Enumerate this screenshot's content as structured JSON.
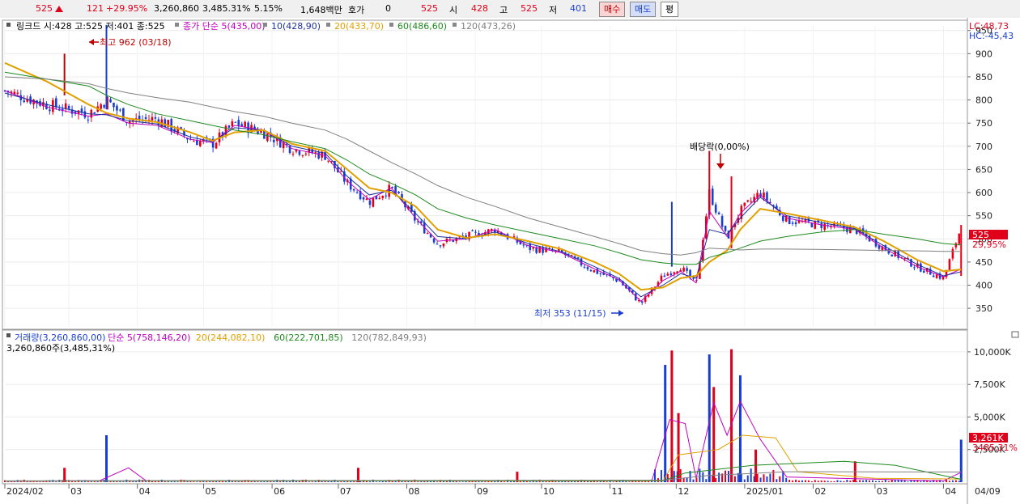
{
  "topbar": {
    "price": "525",
    "change": "121",
    "change_pct": "+29.95%",
    "volume": "3,260,860",
    "volume_pct": "3,485.31%",
    "turnover_rate": "5.15%",
    "amount": "1,648백만",
    "quote_label": "호가",
    "quote_value": "0",
    "quote_price": "525",
    "open_label": "시",
    "open_value": "428",
    "high_label": "고",
    "high_value": "525",
    "low_label": "저",
    "low_value": "401",
    "buy_label": "매수",
    "sell_label": "매도",
    "flat_label": "평"
  },
  "price_panel": {
    "stock_label": "링크드 시:428 고:525 저:401 종:525",
    "ma_legend": [
      {
        "label": "종가 단순 5(435,00)",
        "color": "#c000c0"
      },
      {
        "label": "10(428,90)",
        "color": "#1c2f9c"
      },
      {
        "label": "20(433,70)",
        "color": "#e0a000"
      },
      {
        "label": "60(486,60)",
        "color": "#1e8a1e"
      },
      {
        "label": "120(473,26)",
        "color": "#808080"
      }
    ],
    "lc_label": "LC:48,73",
    "hc_label": "HC:-45,43",
    "annotation_high": "최고 962 (03/18)",
    "annotation_low": "최저 353 (11/15)",
    "annotation_dividend": "배당락(0,00%)",
    "current_price_tag": "525",
    "current_pct_tag": "29,95%"
  },
  "volume_panel": {
    "legend": [
      {
        "label": "거래량(3,260,860,00)",
        "color": "#1a3fd0"
      },
      {
        "label": "단순 5(758,146,20)",
        "color": "#c000c0"
      },
      {
        "label": "20(244,082,10)",
        "color": "#e0a000"
      },
      {
        "label": "60(222,701,85)",
        "color": "#1e8a1e"
      },
      {
        "label": "120(782,849,93)",
        "color": "#808080"
      }
    ],
    "volume_text": "3,260,860주(3,485,31%)",
    "current_volume_tag": "3,261K",
    "current_volume_pct_tag": "3485,31%"
  },
  "chart_data": [
    {
      "type": "candlestick",
      "title": "링크드",
      "y_ticks": [
        350,
        400,
        450,
        500,
        550,
        600,
        650,
        700,
        750,
        800,
        850,
        900,
        950
      ],
      "ylim": [
        310,
        960
      ],
      "x_month_labels": [
        "2024/02",
        "03",
        "04",
        "05",
        "06",
        "07",
        "08",
        "09",
        "10",
        "11",
        "12",
        "2025/01",
        "02",
        "03",
        "04",
        "04/09"
      ],
      "close_trend": [
        {
          "date": "2024-02-01",
          "close": 820
        },
        {
          "date": "2024-02-20",
          "close": 790
        },
        {
          "date": "2024-03-10",
          "close": 770
        },
        {
          "date": "2024-03-18",
          "close": 800
        },
        {
          "date": "2024-03-28",
          "close": 755
        },
        {
          "date": "2024-04-10",
          "close": 760
        },
        {
          "date": "2024-04-25",
          "close": 715
        },
        {
          "date": "2024-05-05",
          "close": 705
        },
        {
          "date": "2024-05-15",
          "close": 750
        },
        {
          "date": "2024-05-28",
          "close": 730
        },
        {
          "date": "2024-06-10",
          "close": 695
        },
        {
          "date": "2024-06-25",
          "close": 680
        },
        {
          "date": "2024-07-05",
          "close": 620
        },
        {
          "date": "2024-07-15",
          "close": 580
        },
        {
          "date": "2024-07-25",
          "close": 610
        },
        {
          "date": "2024-08-05",
          "close": 540
        },
        {
          "date": "2024-08-15",
          "close": 490
        },
        {
          "date": "2024-08-28",
          "close": 505
        },
        {
          "date": "2024-09-10",
          "close": 520
        },
        {
          "date": "2024-09-25",
          "close": 480
        },
        {
          "date": "2024-10-10",
          "close": 470
        },
        {
          "date": "2024-10-25",
          "close": 430
        },
        {
          "date": "2024-11-05",
          "close": 410
        },
        {
          "date": "2024-11-15",
          "close": 360
        },
        {
          "date": "2024-11-25",
          "close": 420
        },
        {
          "date": "2024-12-03",
          "close": 440
        },
        {
          "date": "2024-12-10",
          "close": 400
        },
        {
          "date": "2024-12-16",
          "close": 600
        },
        {
          "date": "2024-12-24",
          "close": 500
        },
        {
          "date": "2024-12-30",
          "close": 560
        },
        {
          "date": "2025-01-08",
          "close": 600
        },
        {
          "date": "2025-01-20",
          "close": 540
        },
        {
          "date": "2025-02-05",
          "close": 530
        },
        {
          "date": "2025-02-20",
          "close": 520
        },
        {
          "date": "2025-03-05",
          "close": 480
        },
        {
          "date": "2025-03-20",
          "close": 440
        },
        {
          "date": "2025-04-01",
          "close": 415
        },
        {
          "date": "2025-04-09",
          "close": 525
        }
      ],
      "series": [
        {
          "name": "5",
          "color": "#c000c0",
          "values": [
            820,
            785,
            765,
            770,
            750,
            745,
            715,
            708,
            745,
            735,
            695,
            680,
            625,
            585,
            610,
            545,
            495,
            500,
            520,
            485,
            470,
            435,
            412,
            365,
            410,
            430,
            405,
            560,
            505,
            555,
            595,
            545,
            530,
            520,
            480,
            440,
            418,
            435
          ]
        },
        {
          "name": "10",
          "color": "#1c2f9c",
          "values": [
            815,
            790,
            770,
            768,
            755,
            748,
            720,
            710,
            740,
            735,
            700,
            685,
            635,
            595,
            605,
            555,
            505,
            500,
            515,
            490,
            472,
            440,
            415,
            375,
            400,
            425,
            415,
            520,
            510,
            545,
            590,
            550,
            535,
            522,
            485,
            445,
            420,
            429
          ]
        },
        {
          "name": "20",
          "color": "#e0a000",
          "values": [
            880,
            840,
            790,
            772,
            760,
            752,
            730,
            712,
            730,
            735,
            705,
            690,
            650,
            610,
            600,
            570,
            520,
            502,
            510,
            495,
            478,
            450,
            425,
            390,
            395,
            415,
            420,
            450,
            475,
            520,
            565,
            555,
            540,
            525,
            495,
            455,
            430,
            434
          ]
        },
        {
          "name": "60",
          "color": "#1e8a1e",
          "values": [
            860,
            845,
            830,
            810,
            790,
            770,
            755,
            745,
            735,
            725,
            710,
            695,
            670,
            640,
            620,
            595,
            565,
            545,
            530,
            515,
            500,
            485,
            470,
            455,
            448,
            445,
            445,
            460,
            470,
            480,
            495,
            505,
            515,
            520,
            510,
            500,
            490,
            487
          ]
        },
        {
          "name": "120",
          "color": "#808080",
          "values": [
            850,
            845,
            835,
            825,
            815,
            805,
            795,
            785,
            775,
            765,
            750,
            735,
            715,
            690,
            665,
            640,
            615,
            590,
            570,
            545,
            525,
            505,
            490,
            475,
            468,
            465,
            470,
            480,
            478,
            476,
            478,
            478,
            477,
            476,
            475,
            474,
            473,
            473
          ]
        }
      ],
      "annotations": [
        {
          "text": "최고 962 (03/18)",
          "date": "2024-03-18",
          "value": 962
        },
        {
          "text": "최저 353 (11/15)",
          "date": "2024-11-15",
          "value": 353
        },
        {
          "text": "배당락(0,00%)",
          "date": "2024-12-27",
          "value": 680
        }
      ]
    },
    {
      "type": "bar",
      "title": "거래량",
      "y_ticks_labels": [
        "2,500K",
        "5,000K",
        "7,500K",
        "10,000K"
      ],
      "y_ticks": [
        2500,
        5000,
        7500,
        10000
      ],
      "ylim": [
        0,
        10800
      ],
      "units": "K",
      "spikes": [
        {
          "date": "2024-02-28",
          "value": 1100
        },
        {
          "date": "2024-03-18",
          "value": 3600
        },
        {
          "date": "2024-07-10",
          "value": 1100
        },
        {
          "date": "2024-09-20",
          "value": 800
        },
        {
          "date": "2024-11-26",
          "value": 9000
        },
        {
          "date": "2024-11-29",
          "value": 10100
        },
        {
          "date": "2024-12-02",
          "value": 5300
        },
        {
          "date": "2024-12-16",
          "value": 9800
        },
        {
          "date": "2024-12-18",
          "value": 7300
        },
        {
          "date": "2024-12-26",
          "value": 10200
        },
        {
          "date": "2024-12-30",
          "value": 8200
        },
        {
          "date": "2025-01-06",
          "value": 2500
        },
        {
          "date": "2025-02-20",
          "value": 1600
        },
        {
          "date": "2025-04-09",
          "value": 3261
        }
      ]
    }
  ]
}
